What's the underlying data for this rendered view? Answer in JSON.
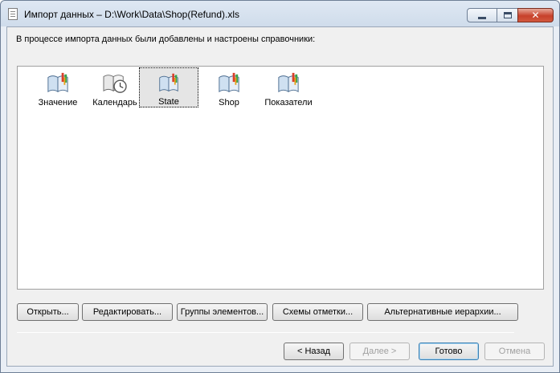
{
  "window": {
    "title": "Импорт данных – D:\\Work\\Data\\Shop(Refund).xls",
    "close_glyph": "✕"
  },
  "intro_text": "В процессе импорта данных были добавлены и настроены справочники:",
  "dictionaries": [
    {
      "label": "Значение",
      "icon": "book-icon"
    },
    {
      "label": "Календарь",
      "icon": "book-clock-icon"
    },
    {
      "label": "State",
      "icon": "book-icon",
      "selected": true
    },
    {
      "label": "Shop",
      "icon": "book-icon"
    },
    {
      "label": "Показатели",
      "icon": "book-icon"
    }
  ],
  "action_buttons": {
    "open": "Открыть...",
    "edit": "Редактировать...",
    "groups": "Группы элементов...",
    "schemes": "Схемы отметки...",
    "hierarchies": "Альтернативные иерархии..."
  },
  "nav_buttons": {
    "back": "< Назад",
    "next": "Далее >",
    "finish": "Готово",
    "cancel": "Отмена"
  }
}
